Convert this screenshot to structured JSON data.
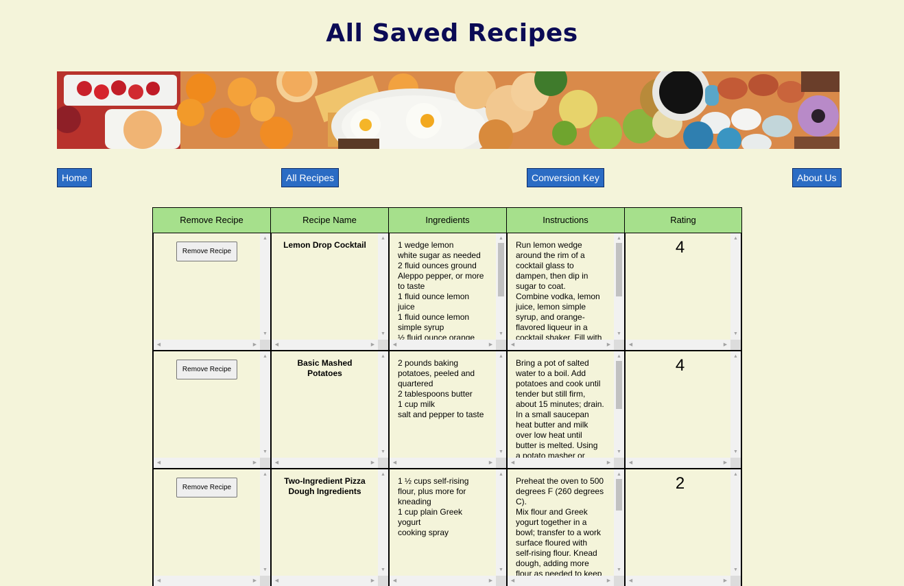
{
  "page": {
    "title": "All Saved Recipes"
  },
  "nav": {
    "home": "Home",
    "all_recipes": "All Recipes",
    "conversion_key": "Conversion Key",
    "about_us": "About Us"
  },
  "table": {
    "headers": [
      "Remove Recipe",
      "Recipe Name",
      "Ingredients",
      "Instructions",
      "Rating"
    ],
    "remove_label": "Remove Recipe",
    "rows": [
      {
        "name": "Lemon Drop Cocktail",
        "ingredients": [
          "1 wedge lemon",
          "white sugar as needed",
          "2 fluid ounces ground",
          "Aleppo pepper, or more",
          "to taste",
          "1 fluid ounce lemon",
          "juice",
          "1 fluid ounce lemon",
          "simple syrup",
          "½ fluid ounce orange"
        ],
        "instructions": [
          "Run lemon wedge",
          "around the rim of a",
          "cocktail glass to",
          "dampen, then dip in",
          "sugar to coat.",
          "Combine vodka, lemon",
          "juice, lemon simple",
          "syrup, and orange-",
          "flavored liqueur in a",
          "cocktail shaker. Fill with"
        ],
        "rating": "4"
      },
      {
        "name": "Basic Mashed Potatoes",
        "ingredients": [
          "2 pounds baking",
          "potatoes, peeled and",
          "quartered",
          "2 tablespoons butter",
          "1 cup milk",
          "salt and pepper to taste"
        ],
        "instructions": [
          "Bring a pot of salted",
          "water to a boil. Add",
          "potatoes and cook until",
          "tender but still firm,",
          "about 15 minutes; drain.",
          "In a small saucepan",
          "heat butter and milk",
          "over low heat until",
          "butter is melted. Using",
          "a potato masher or"
        ],
        "rating": "4"
      },
      {
        "name": "Two-Ingredient Pizza Dough Ingredients",
        "ingredients": [
          "1 ½ cups self-rising",
          "flour, plus more for",
          "kneading",
          "1 cup plain Greek",
          "yogurt",
          "cooking spray"
        ],
        "instructions": [
          "Preheat the oven to 500",
          "degrees F (260 degrees",
          "C).",
          "Mix flour and Greek",
          "yogurt together in a",
          "bowl; transfer to a work",
          "surface floured with",
          "self-rising flour. Knead",
          "dough, adding more",
          "flour as needed to keep"
        ],
        "rating": "2"
      }
    ]
  }
}
